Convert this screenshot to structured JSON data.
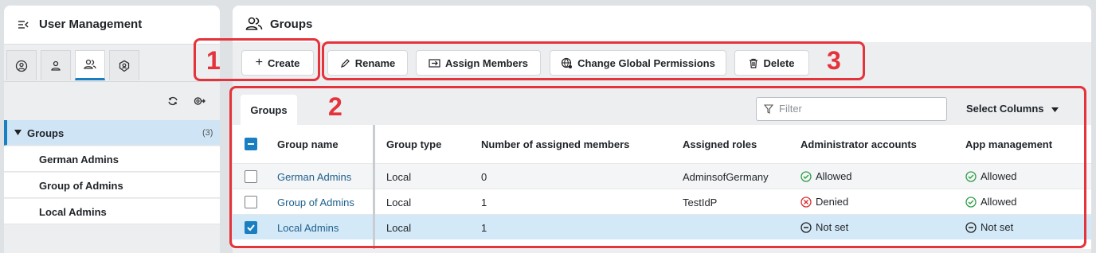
{
  "left_panel": {
    "title": "User Management",
    "tabs": [
      "user-circle-icon",
      "user-icon",
      "users-group-icon",
      "shield-user-icon"
    ],
    "active_tab": 2,
    "tree": {
      "root_label": "Groups",
      "root_count": "(3)",
      "children": [
        "German Admins",
        "Group of Admins",
        "Local Admins"
      ]
    }
  },
  "main_panel": {
    "title": "Groups",
    "toolbar": {
      "create": "Create",
      "rename": "Rename",
      "assign_members": "Assign Members",
      "change_permissions": "Change Global Permissions",
      "delete": "Delete"
    },
    "table_tab": "Groups",
    "filter_placeholder": "Filter",
    "select_columns": "Select Columns",
    "columns": [
      "Group name",
      "Group type",
      "Number of assigned members",
      "Assigned roles",
      "Administrator accounts",
      "App management"
    ],
    "rows": [
      {
        "name": "German Admins",
        "type": "Local",
        "members": "0",
        "roles": "AdminsofGermany",
        "admin": "Allowed",
        "app": "Allowed",
        "checked": false
      },
      {
        "name": "Group of Admins",
        "type": "Local",
        "members": "1",
        "roles": "TestIdP",
        "admin": "Denied",
        "app": "Allowed",
        "checked": false
      },
      {
        "name": "Local Admins",
        "type": "Local",
        "members": "1",
        "roles": "",
        "admin": "Not set",
        "app": "Not set",
        "checked": true
      }
    ]
  },
  "annotations": {
    "label_1": "1",
    "label_2": "2",
    "label_3": "3"
  },
  "colors": {
    "accent": "#1a7fc1",
    "annotation": "#e5333c",
    "allowed": "#2e9e48",
    "denied": "#d93030",
    "selected_row": "#d4e9f7"
  }
}
